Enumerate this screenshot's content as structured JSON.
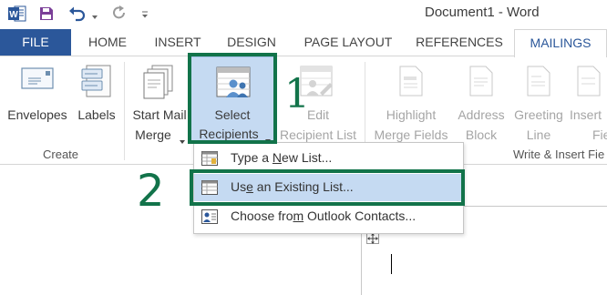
{
  "window": {
    "title": "Document1 - Word"
  },
  "tabs": [
    {
      "label": "FILE"
    },
    {
      "label": "HOME"
    },
    {
      "label": "INSERT"
    },
    {
      "label": "DESIGN"
    },
    {
      "label": "PAGE LAYOUT"
    },
    {
      "label": "REFERENCES"
    },
    {
      "label": "MAILINGS"
    }
  ],
  "ribbon": {
    "envelopes": "Envelopes",
    "labels": "Labels",
    "create_group": "Create",
    "start_mail_merge_1": "Start Mail",
    "start_mail_merge_2": "Merge",
    "select_recipients_1": "Select",
    "select_recipients_2": "Recipients",
    "edit_1": "Edit",
    "edit_2": "Recipient List",
    "highlight_1": "Highlight",
    "highlight_2": "Merge Fields",
    "address_1": "Address",
    "address_2": "Block",
    "greeting_1": "Greeting",
    "greeting_2": "Line",
    "insert_1": "Insert",
    "insert_2": "Fie",
    "write_insert_group": "Write & Insert Fie"
  },
  "dropdown": {
    "items": [
      {
        "pre": "Type a ",
        "ul": "N",
        "post": "ew List..."
      },
      {
        "pre": "Us",
        "ul": "e",
        "post": " an Existing List..."
      },
      {
        "pre": "Choose fro",
        "ul": "m",
        "post": " Outlook Contacts..."
      }
    ]
  },
  "annotations": {
    "step1": "1",
    "step2": "2"
  },
  "colors": {
    "file_tab": "#2b579a",
    "annotation": "#12734a",
    "selected_item": "#c5daf2"
  }
}
